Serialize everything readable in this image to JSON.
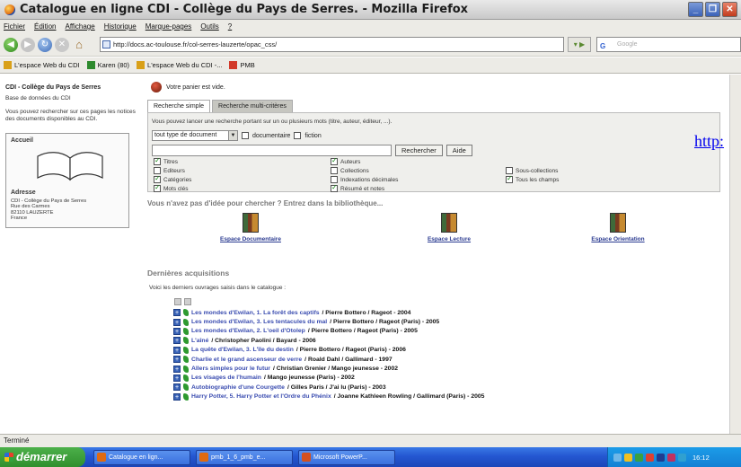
{
  "window": {
    "title": "Catalogue en ligne CDI - Collège du Pays de Serres. - Mozilla Firefox"
  },
  "menu": [
    "Fichier",
    "Édition",
    "Affichage",
    "Historique",
    "Marque-pages",
    "Outils",
    "?"
  ],
  "nav": {
    "url": "http://docs.ac-toulouse.fr/col-serres-lauzerte/opac_css/",
    "search_placeholder": "Google"
  },
  "bookmarks": [
    {
      "label": "L'espace Web du CDI",
      "color": "#d9a018"
    },
    {
      "label": "Karen (80)",
      "color": "#2e8a2e"
    },
    {
      "label": "L'espace Web du CDI -...",
      "color": "#d9a018"
    },
    {
      "label": "PMB",
      "color": "#d23a2a"
    }
  ],
  "sidebar": {
    "site_title": "CDI - Collège du Pays de Serres",
    "db_label": "Base de données du CDI",
    "intro": "Vous pouvez rechercher sur ces pages les notices des documents disponibles au CDI.",
    "accueil": "Accueil",
    "adresse_title": "Adresse",
    "adresse_lines": [
      "CDI - Collège du Pays de Serres",
      "Rue des Carmes",
      "82110 LAUZERTE",
      "France"
    ]
  },
  "main": {
    "basket": "Votre panier est vide.",
    "tab_simple": "Recherche simple",
    "tab_multi": "Recherche multi-critères",
    "search_intro": "Vous pouvez lancer une recherche portant sur un ou plusieurs mots (titre, auteur, éditeur, ...).",
    "doc_type": "tout type de document",
    "cb_documentaire": "documentaire",
    "cb_fiction": "fiction",
    "btn_search": "Rechercher",
    "btn_help": "Aide",
    "options": {
      "titres": "Titres",
      "auteurs": "Auteurs",
      "editeurs": "Editeurs",
      "collections": "Collections",
      "sous_collections": "Sous-collections",
      "categories": "Catégories",
      "indexations": "Indexations décimales",
      "tous_champs": "Tous les champs",
      "mots_cles": "Mots clés",
      "resume": "Résumé et notes"
    },
    "idee": "Vous n'avez pas d'idée pour chercher ? Entrez dans la bibliothèque...",
    "espaces": [
      "Espace Documentaire",
      "Espace Lecture",
      "Espace Orientation"
    ],
    "dernieres": "Dernières acquisitions",
    "voici": "Voici les derniers ouvrages saisis dans le catalogue :",
    "acquisitions": [
      {
        "title": "Les mondes d'Ewilan, 1. La forêt des captifs",
        "rest": " / Pierre Bottero / Rageot - 2004"
      },
      {
        "title": "Les mondes d'Ewilan, 3. Les tentacules du mal",
        "rest": " / Pierre Bottero / Rageot (Paris) - 2005"
      },
      {
        "title": "Les mondes d'Ewilan, 2. L'oeil d'Otolep",
        "rest": " / Pierre Bottero / Rageot (Paris) - 2005"
      },
      {
        "title": "L'aîné",
        "rest": " / Christopher Paolini / Bayard - 2006"
      },
      {
        "title": "La quête d'Ewilan, 3. L'île du destin",
        "rest": " / Pierre Bottero / Rageot (Paris) - 2006"
      },
      {
        "title": "Charlie et le grand ascenseur de verre",
        "rest": " / Roald Dahl / Gallimard - 1997"
      },
      {
        "title": "Allers simples pour le futur",
        "rest": " / Christian Grenier / Mango jeunesse - 2002"
      },
      {
        "title": "Les visages de l'humain",
        "rest": " / Mango jeunesse (Paris) - 2002"
      },
      {
        "title": "Autobiographie d'une Courgette",
        "rest": " / Gilles Paris / J'ai lu (Paris) - 2003"
      },
      {
        "title": "Harry Potter, 5. Harry Potter et l'Ordre du Phénix",
        "rest": " / Joanne Kathleen Rowling / Gallimard (Paris) - 2005"
      }
    ]
  },
  "overlay_link": "http:",
  "status": "Terminé",
  "taskbar": {
    "start": "démarrer",
    "tasks": [
      "Catalogue en lign...",
      "pmb_1_6_pmb_e...",
      "Microsoft PowerP..."
    ],
    "clock": "16:12"
  }
}
